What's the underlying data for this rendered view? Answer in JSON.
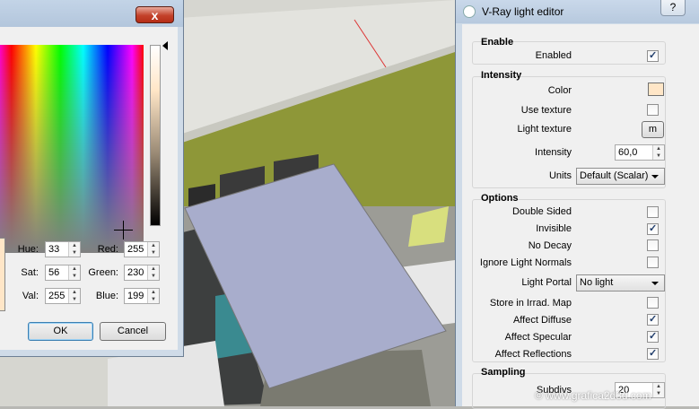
{
  "color_picker": {
    "close_label": "x",
    "hue_label": "Hue:",
    "hue_value": "33",
    "sat_label": "Sat:",
    "sat_value": "56",
    "val_label": "Val:",
    "val_value": "255",
    "red_label": "Red:",
    "red_value": "255",
    "green_label": "Green:",
    "green_value": "230",
    "blue_label": "Blue:",
    "blue_value": "199",
    "ok_label": "OK",
    "cancel_label": "Cancel",
    "current_color": "#ffe6c7"
  },
  "vray_editor": {
    "title": "V-Ray light editor",
    "help_label": "?",
    "enable": {
      "header": "Enable",
      "enabled_label": "Enabled",
      "enabled": true
    },
    "intensity": {
      "header": "Intensity",
      "color_label": "Color",
      "color_value": "#ffe6c7",
      "use_texture_label": "Use texture",
      "use_texture": false,
      "light_texture_label": "Light texture",
      "light_texture_button": "m",
      "intensity_label": "Intensity",
      "intensity_value": "60,0",
      "units_label": "Units",
      "units_value": "Default (Scalar)"
    },
    "options": {
      "header": "Options",
      "double_sided_label": "Double Sided",
      "double_sided": false,
      "invisible_label": "Invisible",
      "invisible": true,
      "no_decay_label": "No Decay",
      "no_decay": false,
      "ignore_light_normals_label": "Ignore Light Normals",
      "ignore_light_normals": false,
      "light_portal_label": "Light Portal",
      "light_portal_value": "No light",
      "store_irrad_label": "Store in Irrad. Map",
      "store_irrad": false,
      "affect_diffuse_label": "Affect Diffuse",
      "affect_diffuse": true,
      "affect_specular_label": "Affect Specular",
      "affect_specular": true,
      "affect_reflections_label": "Affect Reflections",
      "affect_reflections": true
    },
    "sampling": {
      "header": "Sampling",
      "subdivs_label": "Subdivs",
      "subdivs_value": "20"
    }
  },
  "watermark": "© www.grafica2d3d.com"
}
